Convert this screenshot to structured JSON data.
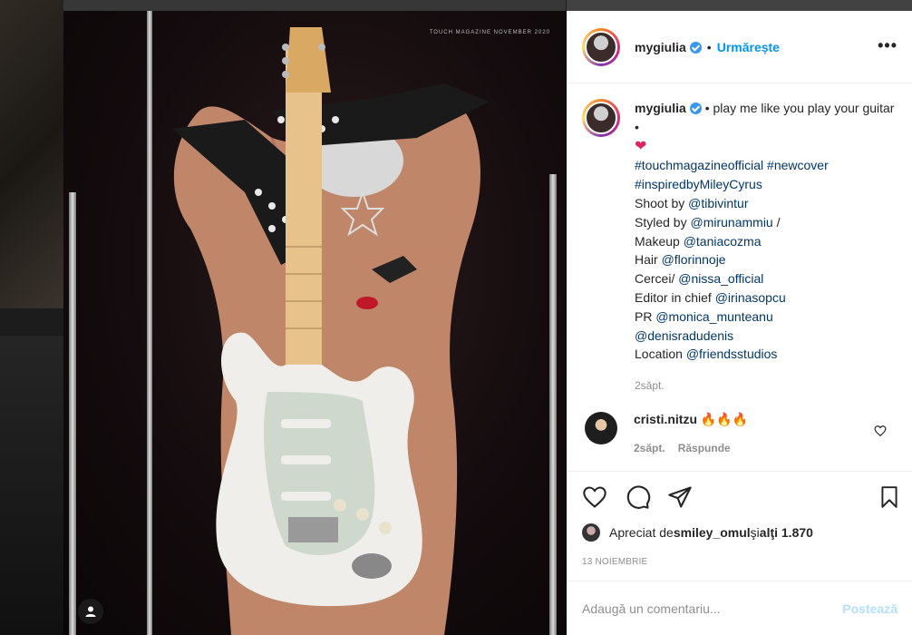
{
  "post": {
    "username": "mygiulia",
    "follow_label": "Urmărește",
    "more_label": "•••",
    "magazine_text": "TOUCH MAGAZINE NOVEMBER 2020",
    "caption": {
      "username": "mygiulia",
      "line1": "• play me like you play your guitar •",
      "heart": "❤",
      "hashtags1": "#touchmagazineofficial #newcover",
      "hashtags2": "#inspiredbyMileyCyrus",
      "shoot_prefix": "Shoot by ",
      "shoot_handle": "@tibivintur",
      "styled_prefix": "Styled by ",
      "styled_handle": "@mirunammiu",
      "styled_suffix": " /",
      "makeup_prefix": "Makeup ",
      "makeup_handle": "@taniacozma",
      "hair_prefix": "Hair ",
      "hair_handle": "@florinnoje",
      "cercei_prefix": "Cercei/ ",
      "cercei_handle": "@nissa_official",
      "editor_prefix": "Editor in chief ",
      "editor_handle": "@irinasopcu",
      "pr_prefix": "PR ",
      "pr_handle": "@monica_munteanu",
      "extra_handle": "@denisradudenis",
      "location_prefix": "Location ",
      "location_handle": "@friendsstudios",
      "time": "2săpt."
    },
    "comments": [
      {
        "username": "cristi.nitzu",
        "text": "🔥🔥🔥",
        "time": "2săpt.",
        "reply_label": "Răspunde"
      }
    ],
    "likes": {
      "prefix": "Apreciat de ",
      "user": "smiley_omul",
      "middle": " şi ",
      "others": "alţi 1.870"
    },
    "date": "13 NOIEMBRIE",
    "comment_input": {
      "placeholder": "Adaugă un comentariu...",
      "post_label": "Postează"
    }
  }
}
